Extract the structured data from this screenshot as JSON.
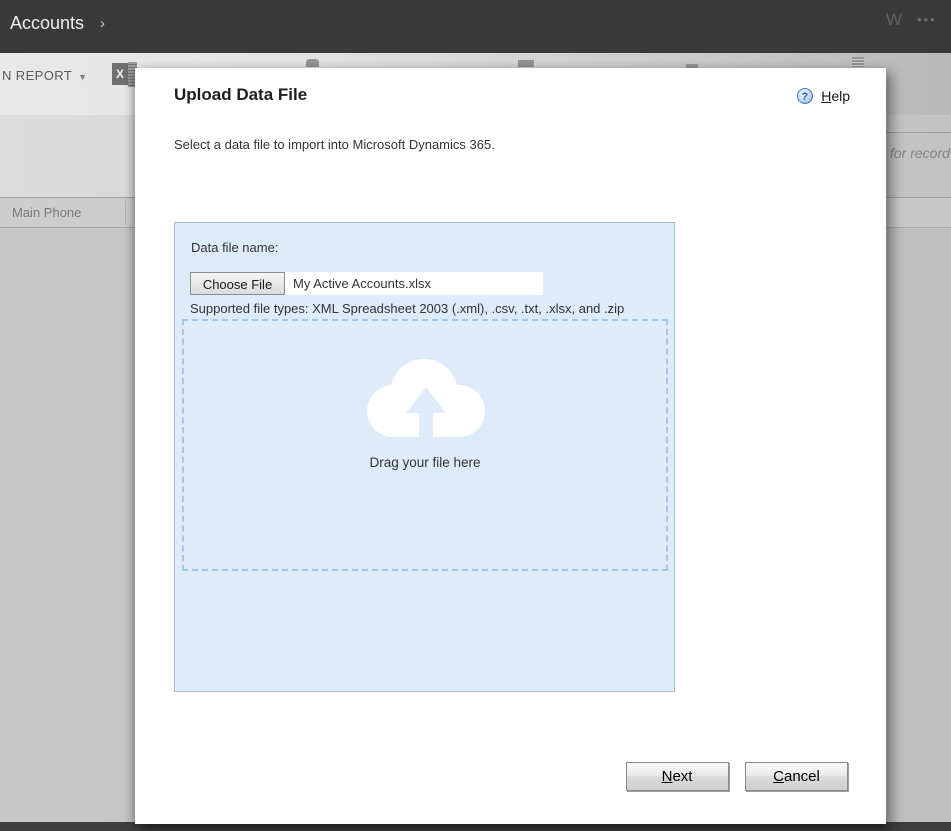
{
  "topnav": {
    "title": "Accounts",
    "chevron": "›"
  },
  "toolbar": {
    "run_report_label": "N REPORT",
    "caret": "▼",
    "excel_glyph": "X",
    "new_fragment": "W",
    "more_label": "•••"
  },
  "search": {
    "visible_text": "for record"
  },
  "grid": {
    "column_header": "Main Phone"
  },
  "dialog": {
    "title": "Upload Data File",
    "help_label": "Help",
    "help_glyph": "?",
    "subtitle": "Select a data file to import into Microsoft Dynamics 365.",
    "file_label": "Data file name:",
    "choose_file_label": "Choose File",
    "file_name": "My Active Accounts.xlsx",
    "supported_types": "Supported file types: XML Spreadsheet 2003 (.xml), .csv, .txt, .xlsx, and .zip",
    "dropzone_label": "Drag your file here",
    "next_label": "Next",
    "cancel_label": "Cancel"
  },
  "colors": {
    "topnav_bg": "#3A3A3A",
    "panel_bg": "#DEEBFA",
    "panel_border": "#A7BED8",
    "dropzone_dash": "#A3C5E8",
    "dialog_bg": "#FFFFFF"
  }
}
